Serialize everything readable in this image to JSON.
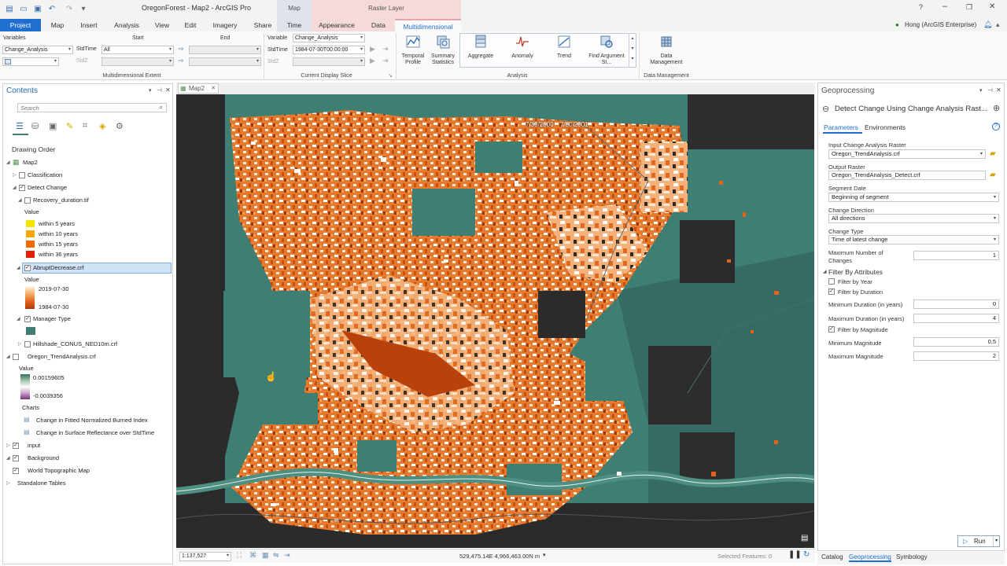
{
  "titlebar": {
    "title": "OregonForest - Map2 - ArcGIS Pro",
    "ctx_map": "Map",
    "ctx_raster": "Raster Layer",
    "user": "Hong (ArcGIS Enterprise)",
    "help": "?"
  },
  "tabs": [
    "Project",
    "Map",
    "Insert",
    "Analysis",
    "View",
    "Edit",
    "Imagery",
    "Share",
    "Time",
    "Appearance",
    "Data",
    "Multidimensional"
  ],
  "ribbon": {
    "variables_label": "Variables",
    "start_label": "Start",
    "end_label": "End",
    "variable_value": "Change_Analysis",
    "stdtime_label": "StdTime",
    "stdtime_value": "All",
    "stdz_label": "StdZ",
    "extent_group": "Multidimensional Extent",
    "cds_variable_label": "Variable",
    "cds_variable_value": "Change_Analysis",
    "cds_stdtime_label": "StdTime",
    "cds_stdtime_value": "1984-07-30T00:00:00",
    "cds_stdz_label": "StdZ",
    "cds_group": "Current Display Slice",
    "temporal_profile": "Temporal Profile",
    "summary_statistics": "Summary Statistics",
    "aggregate": "Aggregate",
    "anomaly": "Anomaly",
    "trend": "Trend",
    "find_argument": "Find Argument St...",
    "analysis_group": "Analysis",
    "data_management": "Data Management",
    "data_management_group": "Data Management"
  },
  "contents": {
    "title": "Contents",
    "search_placeholder": "Search",
    "drawing_order": "Drawing Order",
    "map": "Map2",
    "classification": "Classification",
    "detect_change": "Detect Change",
    "recovery": "Recovery_duration.tif",
    "value": "Value",
    "recovery_classes": [
      {
        "label": "within 5 years",
        "color": "#f5e400"
      },
      {
        "label": "within 10 years",
        "color": "#f7a800"
      },
      {
        "label": "within 15 years",
        "color": "#f06a00"
      },
      {
        "label": "within 36 years",
        "color": "#e02000"
      }
    ],
    "abrupt": "AbruptDecrease.crf",
    "abrupt_max": "2019-07-30",
    "abrupt_min": "1984-07-30",
    "manager_type": "Manager Type",
    "hillshade": "Hillshade_CONUS_NED10m.crf",
    "trend": "Oregon_TrendAnalysis.crf",
    "trend_max": "0.00159605",
    "trend_min": "-0.0039356",
    "charts": "Charts",
    "chart1": "Change in Fitted Normalized Burned Index",
    "chart2": "Change in  Surface Reflectance over StdTime",
    "input": "input",
    "background": "Background",
    "topo": "World Topographic Map",
    "standalone": "Standalone Tables"
  },
  "map": {
    "tab": "Map2",
    "time_start": "7/30/2000",
    "time_end": "7/30/2001",
    "scale": "1:137,527",
    "coords": "529,475.14E 4,966,463.00N m",
    "selected": "Selected Features: 0"
  },
  "colors": {
    "accent": "#1a6fd1",
    "teal": "#3f7f73",
    "orange": "#e07a2a"
  },
  "geoprocessing": {
    "title": "Geoprocessing",
    "tool": "Detect Change Using Change Analysis Rast...",
    "parameters_tab": "Parameters",
    "environments_tab": "Environments",
    "input_label": "Input Change Analysis Raster",
    "input_value": "Oregon_TrendAnalysis.crf",
    "output_label": "Output Raster",
    "output_value": "Oregon_TrendAnalysis_Detect.crf",
    "segment_label": "Segment Date",
    "segment_value": "Beginning of segment",
    "direction_label": "Change Direction",
    "direction_value": "All directions",
    "type_label": "Change Type",
    "type_value": "Time  of latest change",
    "maxchanges_label1": "Maximum Number of",
    "maxchanges_label2": "Changes",
    "maxchanges_value": "1",
    "filter_header": "Filter By Attributes",
    "filter_year": "Filter by Year",
    "filter_duration": "Filter by Duration",
    "min_duration_label": "Minimum  Duration (in years)",
    "min_duration_value": "0",
    "max_duration_label": "Maximum  Duration (in years)",
    "max_duration_value": "4",
    "filter_magnitude": "Filter by Magnitude",
    "min_mag_label": "Minimum  Magnitude",
    "min_mag_value": "0.5",
    "max_mag_label": "Maximum  Magnitude",
    "max_mag_value": "2",
    "run": "Run"
  },
  "bottom_tabs": [
    "Catalog",
    "Geoprocessing",
    "Symbology"
  ]
}
